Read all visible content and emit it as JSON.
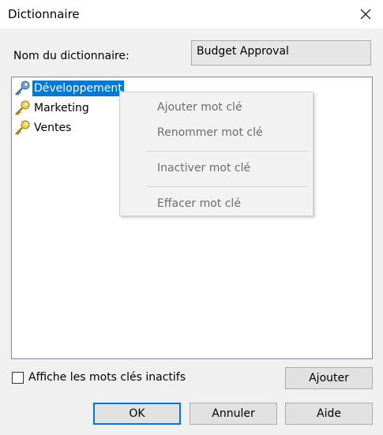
{
  "window": {
    "title": "Dictionnaire"
  },
  "form": {
    "name_label": "Nom du dictionnaire:",
    "name_value": "Budget Approval"
  },
  "tree": {
    "items": [
      {
        "label": "Développement",
        "icon": "key-icon",
        "selected": true
      },
      {
        "label": "Marketing",
        "icon": "key-icon",
        "selected": false
      },
      {
        "label": "Ventes",
        "icon": "key-icon",
        "selected": false
      }
    ]
  },
  "context_menu": {
    "items": [
      {
        "label": "Ajouter mot clé",
        "enabled": false
      },
      {
        "label": "Renommer mot clé",
        "enabled": false
      },
      {
        "label": "Inactiver mot clé",
        "enabled": false
      },
      {
        "label": "Effacer mot clé",
        "enabled": false
      }
    ]
  },
  "options": {
    "show_inactive_label": "Affiche les mots clés inactifs",
    "show_inactive_checked": false
  },
  "buttons": {
    "add": "Ajouter",
    "ok": "OK",
    "cancel": "Annuler",
    "help": "Aide"
  },
  "colors": {
    "selection": "#0078d7",
    "key_gold": "#e0b030",
    "key_blue": "#4a7fb0"
  }
}
